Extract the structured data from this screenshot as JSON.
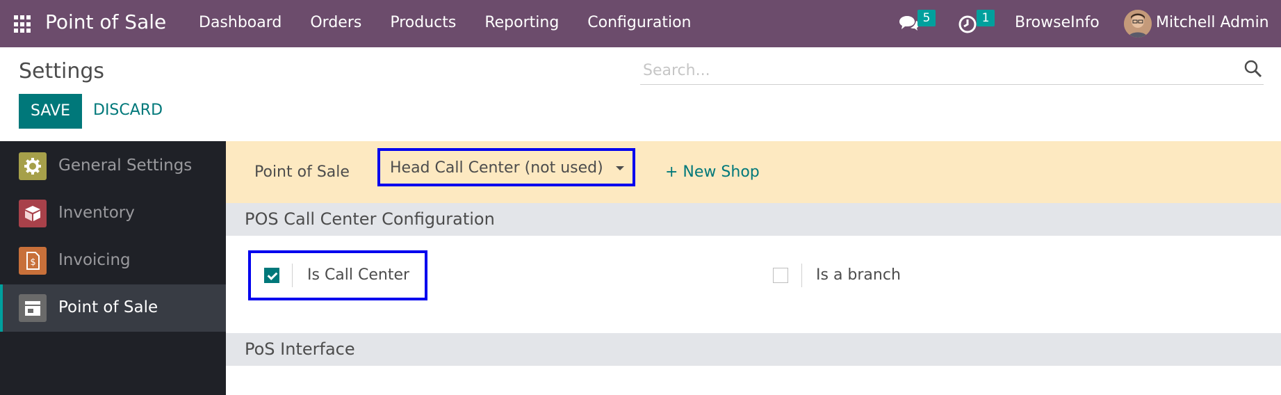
{
  "navbar": {
    "app_title": "Point of Sale",
    "menu": [
      "Dashboard",
      "Orders",
      "Products",
      "Reporting",
      "Configuration"
    ],
    "messages_count": "5",
    "activities_count": "1",
    "company": "BrowseInfo",
    "user": "Mitchell Admin"
  },
  "control": {
    "title": "Settings",
    "search_placeholder": "Search...",
    "save_label": "SAVE",
    "discard_label": "DISCARD"
  },
  "sidebar": {
    "items": [
      {
        "label": "General Settings",
        "icon": "gear-icon",
        "color": "#a6a04a"
      },
      {
        "label": "Inventory",
        "icon": "box-icon",
        "color": "#a8414a"
      },
      {
        "label": "Invoicing",
        "icon": "invoice-icon",
        "color": "#c8703a"
      },
      {
        "label": "Point of Sale",
        "icon": "shop-icon",
        "color": "#6a6a6a"
      }
    ],
    "active": "Point of Sale"
  },
  "shop_bar": {
    "label": "Point of Sale",
    "selected_shop": "Head Call Center (not used)",
    "new_shop_label": "+ New Shop"
  },
  "sections": {
    "call_center": {
      "title": "POS Call Center Configuration",
      "is_call_center_label": "Is Call Center",
      "is_call_center_checked": true,
      "is_branch_label": "Is a branch",
      "is_branch_checked": false
    },
    "interface": {
      "title": "PoS Interface"
    }
  },
  "colors": {
    "navbar": "#6c4c6c",
    "primary": "#00787a",
    "badge": "#00a09d",
    "highlight": "#0000ee",
    "shop_bar": "#fde9c1"
  }
}
